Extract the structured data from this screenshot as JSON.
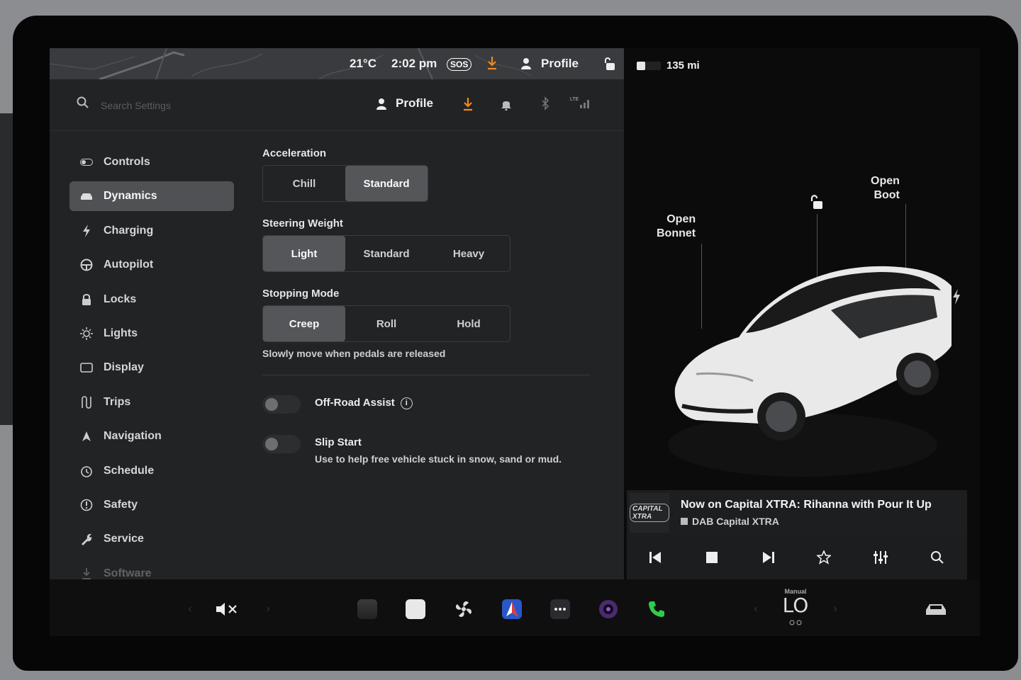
{
  "status_bar": {
    "temperature": "21°C",
    "time": "2:02 pm",
    "sos": "SOS",
    "profile": "Profile"
  },
  "header": {
    "search_placeholder": "Search Settings",
    "profile": "Profile",
    "lte": "LTE"
  },
  "sidebar": {
    "items": [
      {
        "label": "Controls",
        "icon": "toggle-icon"
      },
      {
        "label": "Dynamics",
        "icon": "car-icon",
        "active": true
      },
      {
        "label": "Charging",
        "icon": "bolt-icon"
      },
      {
        "label": "Autopilot",
        "icon": "steering-wheel-icon"
      },
      {
        "label": "Locks",
        "icon": "lock-icon"
      },
      {
        "label": "Lights",
        "icon": "light-icon"
      },
      {
        "label": "Display",
        "icon": "display-icon"
      },
      {
        "label": "Trips",
        "icon": "trips-icon"
      },
      {
        "label": "Navigation",
        "icon": "navigation-icon"
      },
      {
        "label": "Schedule",
        "icon": "clock-icon"
      },
      {
        "label": "Safety",
        "icon": "safety-icon"
      },
      {
        "label": "Service",
        "icon": "wrench-icon"
      },
      {
        "label": "Software",
        "icon": "download-icon"
      }
    ]
  },
  "dynamics": {
    "acceleration": {
      "label": "Acceleration",
      "options": [
        "Chill",
        "Standard"
      ],
      "selected": "Standard"
    },
    "steering_weight": {
      "label": "Steering Weight",
      "options": [
        "Light",
        "Standard",
        "Heavy"
      ],
      "selected": "Light"
    },
    "stopping_mode": {
      "label": "Stopping Mode",
      "options": [
        "Creep",
        "Roll",
        "Hold"
      ],
      "selected": "Creep",
      "hint": "Slowly move when pedals are released"
    },
    "off_road_assist": {
      "label": "Off-Road Assist",
      "enabled": false
    },
    "slip_start": {
      "label": "Slip Start",
      "description": "Use to help free vehicle stuck in snow, sand or mud.",
      "enabled": false
    }
  },
  "car_panel": {
    "range": "135 mi",
    "open_bonnet": [
      "Open",
      "Bonnet"
    ],
    "open_boot": [
      "Open",
      "Boot"
    ]
  },
  "media": {
    "logo_text": "CAPITAL XTRA",
    "track": "Now on Capital XTRA: Rihanna with Pour It Up",
    "station": "DAB Capital XTRA"
  },
  "dock": {
    "climate_label": "Manual",
    "temperature": "LO"
  },
  "colors": {
    "accent_orange": "#f08a1c",
    "phone_green": "#2ecc4a",
    "panel_bg": "#222325",
    "selected_bg": "#555659"
  }
}
